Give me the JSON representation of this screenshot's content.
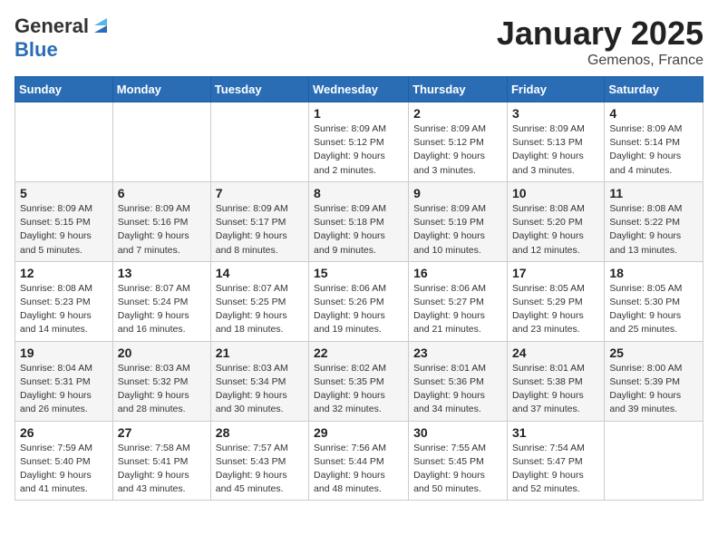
{
  "header": {
    "logo_general": "General",
    "logo_blue": "Blue",
    "month": "January 2025",
    "location": "Gemenos, France"
  },
  "weekdays": [
    "Sunday",
    "Monday",
    "Tuesday",
    "Wednesday",
    "Thursday",
    "Friday",
    "Saturday"
  ],
  "weeks": [
    [
      {
        "day": "",
        "info": ""
      },
      {
        "day": "",
        "info": ""
      },
      {
        "day": "",
        "info": ""
      },
      {
        "day": "1",
        "info": "Sunrise: 8:09 AM\nSunset: 5:12 PM\nDaylight: 9 hours\nand 2 minutes."
      },
      {
        "day": "2",
        "info": "Sunrise: 8:09 AM\nSunset: 5:12 PM\nDaylight: 9 hours\nand 3 minutes."
      },
      {
        "day": "3",
        "info": "Sunrise: 8:09 AM\nSunset: 5:13 PM\nDaylight: 9 hours\nand 3 minutes."
      },
      {
        "day": "4",
        "info": "Sunrise: 8:09 AM\nSunset: 5:14 PM\nDaylight: 9 hours\nand 4 minutes."
      }
    ],
    [
      {
        "day": "5",
        "info": "Sunrise: 8:09 AM\nSunset: 5:15 PM\nDaylight: 9 hours\nand 5 minutes."
      },
      {
        "day": "6",
        "info": "Sunrise: 8:09 AM\nSunset: 5:16 PM\nDaylight: 9 hours\nand 7 minutes."
      },
      {
        "day": "7",
        "info": "Sunrise: 8:09 AM\nSunset: 5:17 PM\nDaylight: 9 hours\nand 8 minutes."
      },
      {
        "day": "8",
        "info": "Sunrise: 8:09 AM\nSunset: 5:18 PM\nDaylight: 9 hours\nand 9 minutes."
      },
      {
        "day": "9",
        "info": "Sunrise: 8:09 AM\nSunset: 5:19 PM\nDaylight: 9 hours\nand 10 minutes."
      },
      {
        "day": "10",
        "info": "Sunrise: 8:08 AM\nSunset: 5:20 PM\nDaylight: 9 hours\nand 12 minutes."
      },
      {
        "day": "11",
        "info": "Sunrise: 8:08 AM\nSunset: 5:22 PM\nDaylight: 9 hours\nand 13 minutes."
      }
    ],
    [
      {
        "day": "12",
        "info": "Sunrise: 8:08 AM\nSunset: 5:23 PM\nDaylight: 9 hours\nand 14 minutes."
      },
      {
        "day": "13",
        "info": "Sunrise: 8:07 AM\nSunset: 5:24 PM\nDaylight: 9 hours\nand 16 minutes."
      },
      {
        "day": "14",
        "info": "Sunrise: 8:07 AM\nSunset: 5:25 PM\nDaylight: 9 hours\nand 18 minutes."
      },
      {
        "day": "15",
        "info": "Sunrise: 8:06 AM\nSunset: 5:26 PM\nDaylight: 9 hours\nand 19 minutes."
      },
      {
        "day": "16",
        "info": "Sunrise: 8:06 AM\nSunset: 5:27 PM\nDaylight: 9 hours\nand 21 minutes."
      },
      {
        "day": "17",
        "info": "Sunrise: 8:05 AM\nSunset: 5:29 PM\nDaylight: 9 hours\nand 23 minutes."
      },
      {
        "day": "18",
        "info": "Sunrise: 8:05 AM\nSunset: 5:30 PM\nDaylight: 9 hours\nand 25 minutes."
      }
    ],
    [
      {
        "day": "19",
        "info": "Sunrise: 8:04 AM\nSunset: 5:31 PM\nDaylight: 9 hours\nand 26 minutes."
      },
      {
        "day": "20",
        "info": "Sunrise: 8:03 AM\nSunset: 5:32 PM\nDaylight: 9 hours\nand 28 minutes."
      },
      {
        "day": "21",
        "info": "Sunrise: 8:03 AM\nSunset: 5:34 PM\nDaylight: 9 hours\nand 30 minutes."
      },
      {
        "day": "22",
        "info": "Sunrise: 8:02 AM\nSunset: 5:35 PM\nDaylight: 9 hours\nand 32 minutes."
      },
      {
        "day": "23",
        "info": "Sunrise: 8:01 AM\nSunset: 5:36 PM\nDaylight: 9 hours\nand 34 minutes."
      },
      {
        "day": "24",
        "info": "Sunrise: 8:01 AM\nSunset: 5:38 PM\nDaylight: 9 hours\nand 37 minutes."
      },
      {
        "day": "25",
        "info": "Sunrise: 8:00 AM\nSunset: 5:39 PM\nDaylight: 9 hours\nand 39 minutes."
      }
    ],
    [
      {
        "day": "26",
        "info": "Sunrise: 7:59 AM\nSunset: 5:40 PM\nDaylight: 9 hours\nand 41 minutes."
      },
      {
        "day": "27",
        "info": "Sunrise: 7:58 AM\nSunset: 5:41 PM\nDaylight: 9 hours\nand 43 minutes."
      },
      {
        "day": "28",
        "info": "Sunrise: 7:57 AM\nSunset: 5:43 PM\nDaylight: 9 hours\nand 45 minutes."
      },
      {
        "day": "29",
        "info": "Sunrise: 7:56 AM\nSunset: 5:44 PM\nDaylight: 9 hours\nand 48 minutes."
      },
      {
        "day": "30",
        "info": "Sunrise: 7:55 AM\nSunset: 5:45 PM\nDaylight: 9 hours\nand 50 minutes."
      },
      {
        "day": "31",
        "info": "Sunrise: 7:54 AM\nSunset: 5:47 PM\nDaylight: 9 hours\nand 52 minutes."
      },
      {
        "day": "",
        "info": ""
      }
    ]
  ]
}
